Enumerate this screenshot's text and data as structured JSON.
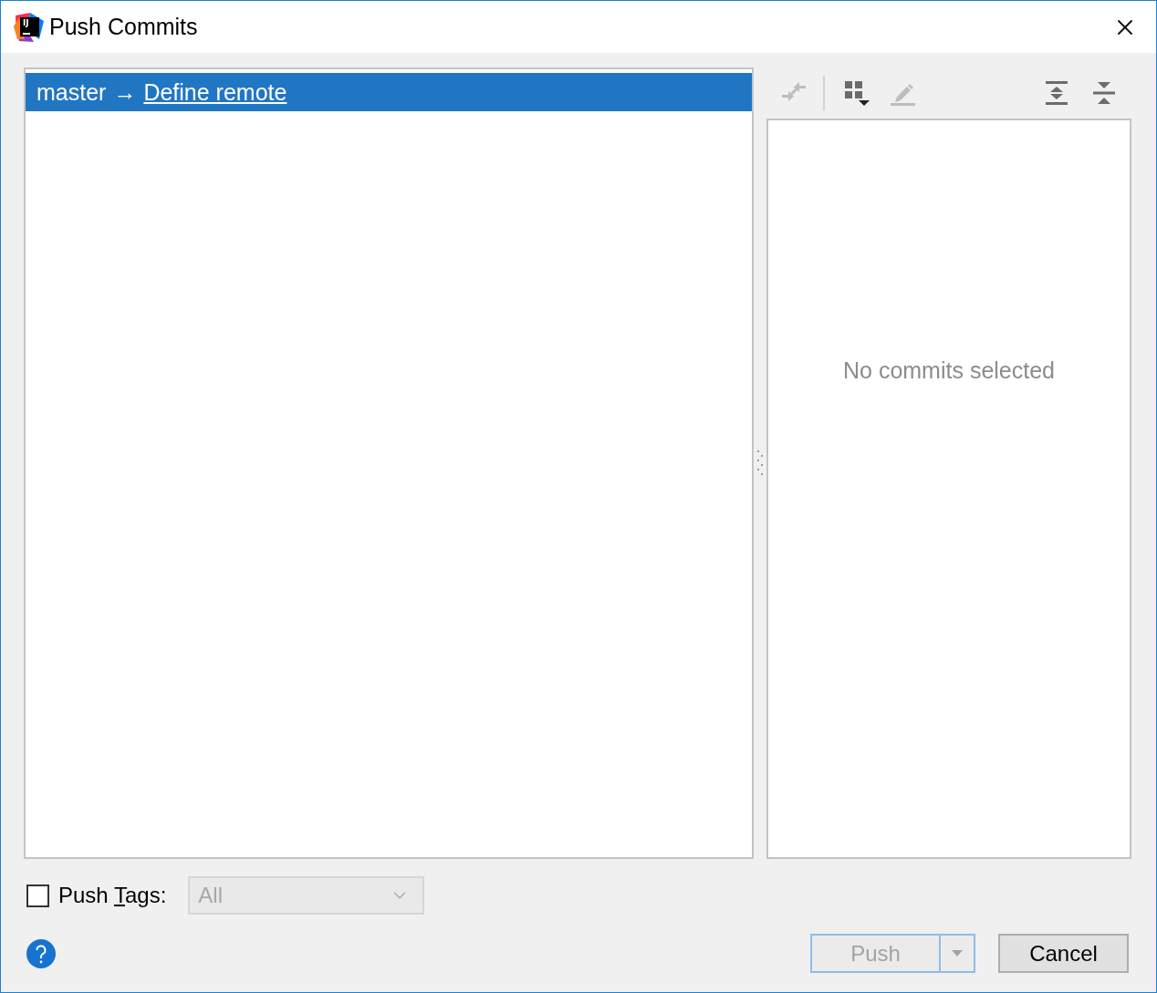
{
  "window": {
    "title": "Push Commits",
    "logo_text": "IJ"
  },
  "branches": [
    {
      "source": "master",
      "arrow": "→",
      "target": "Define remote",
      "selected": true
    }
  ],
  "details_toolbar": {
    "left_groups": [
      [
        {
          "kind": "merge",
          "disabled": true
        }
      ],
      [
        {
          "kind": "grid",
          "disabled": false
        },
        {
          "kind": "pencil",
          "disabled": true
        }
      ]
    ],
    "right": [
      {
        "kind": "expand",
        "disabled": false
      },
      {
        "kind": "collapse",
        "disabled": false
      }
    ]
  },
  "details": {
    "empty_text": "No commits selected"
  },
  "push_tags": {
    "checked": false,
    "label_before": "Push ",
    "mnemonic": "T",
    "label_after": "ags:",
    "dropdown": {
      "value": "All",
      "disabled": true
    }
  },
  "buttons": [
    {
      "label": "Push",
      "kind": "split",
      "disabled": true,
      "default": true
    },
    {
      "label": "Cancel",
      "kind": "plain",
      "disabled": false,
      "default": false
    }
  ]
}
